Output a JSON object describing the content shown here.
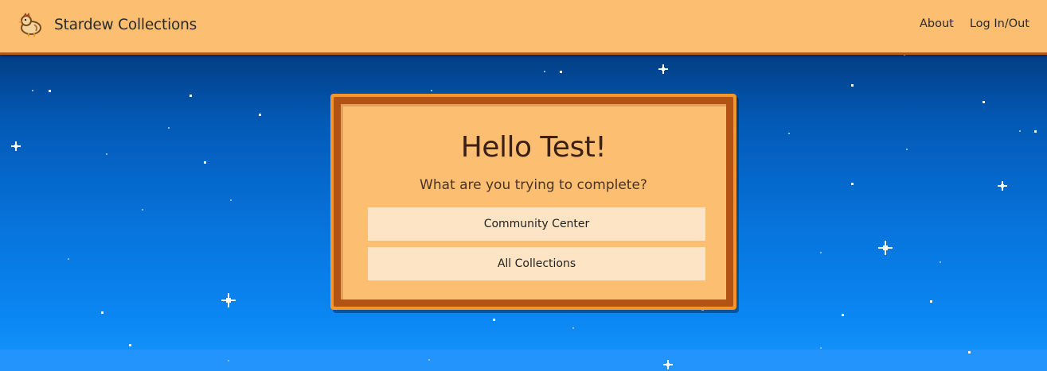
{
  "app": {
    "title": "Stardew Collections",
    "logo_icon": "chicken-icon"
  },
  "nav": {
    "links": [
      "About",
      "Log In/Out"
    ]
  },
  "card": {
    "greeting": "Hello Test!",
    "question": "What are you trying to complete?",
    "options": [
      "Community Center",
      "All Collections"
    ]
  },
  "colors": {
    "header": "#fcbf72",
    "header_border": "#b45a16",
    "card_outer": "#f3962f",
    "card_border": "#b25314",
    "button_bg": "#fde4c5",
    "sky_top": "#00255a",
    "sky_bottom": "#1796ff"
  }
}
